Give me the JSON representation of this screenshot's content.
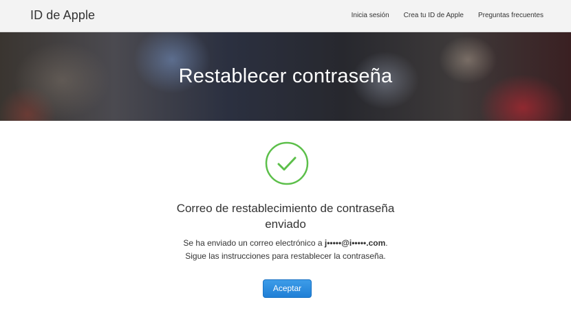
{
  "header": {
    "brand": "ID de Apple",
    "links": [
      "Inicia sesión",
      "Crea tu ID de Apple",
      "Preguntas frecuentes"
    ]
  },
  "hero": {
    "title": "Restablecer contraseña"
  },
  "confirmation": {
    "icon": "checkmark-circle-icon",
    "icon_color": "#5cbf4a",
    "headline_line1": "Correo de restablecimiento de contraseña",
    "headline_line2": "enviado",
    "message_prefix": "Se ha enviado un correo electrónico a ",
    "email": "j•••••@i•••••.com",
    "message_suffix": ".",
    "message_line2": "Sigue las instrucciones para restablecer la contraseña.",
    "button_label": "Aceptar",
    "button_color": "#2a8ae0"
  }
}
